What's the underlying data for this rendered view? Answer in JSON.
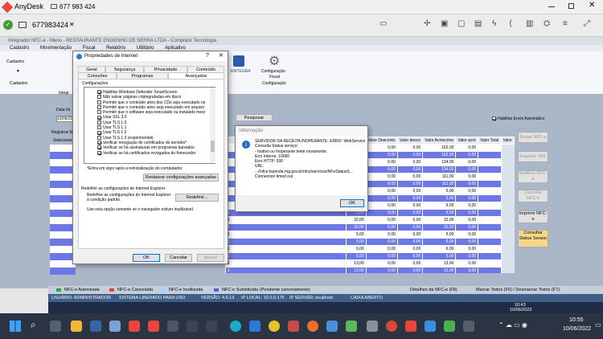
{
  "anydesk": {
    "app_name": "AnyDesk",
    "address_value": "677 983 424",
    "session_tab_label": "677983424"
  },
  "remote_app": {
    "window_title": "Integrador NFC-e - Menu - RESTAURANTE ENGENHO DE SERRA LTDA - Compilest Tecnologia",
    "menu": [
      "Cadastro",
      "Movimentação",
      "Fiscal",
      "Relatório",
      "Utilitário",
      "Aplicativo"
    ],
    "ribbon": {
      "left_button": "Cadastro",
      "left_group": "Cadastro",
      "integr_label": "Integr",
      "sintegra": "SINTEGRA",
      "config_line1": "Configuração",
      "config_line2": "Fiscal",
      "config_group": "Configuração"
    },
    "filter": {
      "data_label": "Data Ini",
      "data_value": "10/06/202",
      "search_button": "Pesquisar",
      "auto_label": "Habilitar Envio Automático"
    },
    "left_labels": {
      "registros": "Registros N",
      "selecionar": "Selecionar"
    },
    "grid": {
      "headers": [
        "SubTotal",
        "Valor Desconto",
        "Valor desco",
        "Valor Acréscimo",
        "Valor acré",
        "Valor Total",
        "Valor"
      ],
      "rows": [
        {
          "q": "",
          "v": [
            "162,00",
            "0,00",
            "0,00",
            "162,00",
            "0,00"
          ]
        },
        {
          "q": "",
          "v": [
            "162,00",
            "0,00",
            "0,00",
            "162,00",
            "0,00"
          ]
        },
        {
          "q": "",
          "v": [
            "134,00",
            "0,00",
            "0,00",
            "134,00",
            "0,00"
          ]
        },
        {
          "q": "",
          "v": [
            "134,00",
            "0,00",
            "0,00",
            "134,00",
            "0,00"
          ]
        },
        {
          "q": "",
          "v": [
            "111,00",
            "0,00",
            "0,00",
            "111,00",
            "0,00"
          ]
        },
        {
          "q": "",
          "v": [
            "111,00",
            "0,00",
            "0,00",
            "111,00",
            "0,00"
          ]
        },
        {
          "q": "",
          "v": [
            "5,00",
            "0,00",
            "0,00",
            "5,00",
            "0,00"
          ]
        },
        {
          "q": "",
          "v": [
            "5,00",
            "0,00",
            "0,00",
            "5,00",
            "0,00"
          ]
        },
        {
          "q": "",
          "v": [
            "9,00",
            "0,00",
            "0,00",
            "9,00",
            "0,00"
          ]
        },
        {
          "q": "1",
          "v": [
            "9,00",
            "0,00",
            "0,00",
            "9,00",
            "0,00"
          ]
        },
        {
          "q": "1",
          "v": [
            "32,00",
            "0,00",
            "0,00",
            "32,00",
            "0,00"
          ]
        },
        {
          "q": "1",
          "v": [
            "32,00",
            "0,00",
            "0,00",
            "32,00",
            "0,00"
          ]
        },
        {
          "q": "1",
          "v": [
            "5,00",
            "0,00",
            "0,00",
            "5,00",
            "0,00"
          ]
        },
        {
          "q": "1",
          "v": [
            "5,00",
            "0,00",
            "0,00",
            "5,00",
            "0,00"
          ]
        },
        {
          "q": "1",
          "v": [
            "6,00",
            "0,00",
            "0,00",
            "6,00",
            "0,00"
          ]
        },
        {
          "q": "1",
          "v": [
            "6,00",
            "0,00",
            "0,00",
            "6,00",
            "0,00"
          ]
        },
        {
          "q": "1",
          "v": [
            "13,00",
            "0,00",
            "0,00",
            "13,00",
            "0,00"
          ]
        },
        {
          "q": "1",
          "v": [
            "13,00",
            "0,00",
            "0,00",
            "13,00",
            "0,00"
          ]
        }
      ]
    },
    "side_buttons": [
      "Enviar NFC-e",
      "Exportar XML",
      "Inutilizar NFC-e",
      "Cancelar NFC-e",
      "Imprimir NFC-e",
      "Consultar Status Sensor"
    ],
    "legend": {
      "autorizada": "NFC-e Autorizada",
      "cancelada": "NFC-e Cancelada",
      "inutilizada": "NFC-e Inutilizada",
      "substituida": "NFC-e Substituída (Pendente cancelamento)",
      "detalhes": "Detalhes da NFC-e (F8)",
      "marcar": "Marcar Todos (F6) / Desmarcar Todos (F7)"
    },
    "statusbar": {
      "usuario": "USUÁRIO: ADMINISTRADOR",
      "sistema": "SISTEMA LIBERADO PARA USO",
      "versao": "VERSÃO: 4.6.13",
      "ip_local": "IP LOCAL: 10.0.0.175",
      "ip_server": "IP SERVER: localhost",
      "caixa": "CAIXA ABERTO"
    }
  },
  "internet_dialog": {
    "title": "Propriedades de Internet",
    "help": "?",
    "tabs_row1": [
      "Geral",
      "Segurança",
      "Privacidade",
      "Conteúdo"
    ],
    "tabs_row2": [
      "Conexões",
      "Programas",
      "Avançadas"
    ],
    "section": "Configurações",
    "items": [
      {
        "on": true,
        "t": "Habilitar Windows Defender SmartScreen"
      },
      {
        "on": false,
        "t": "Não salvar páginas criptografadas em disco"
      },
      {
        "on": false,
        "t": "Permitir que o conteúdo ativo dos CDs seja executado no"
      },
      {
        "on": false,
        "t": "Permitir que o conteúdo ativo seja executado em arquivo"
      },
      {
        "on": false,
        "t": "Permitir que o software seja executado ou instalado mesr"
      },
      {
        "on": true,
        "t": "Usar SSL 3.0"
      },
      {
        "on": false,
        "t": "Usar TLS 1.0"
      },
      {
        "on": false,
        "t": "Usar TLS 1.1"
      },
      {
        "on": true,
        "t": "Usar TLS 1.2"
      },
      {
        "on": false,
        "t": "Usar TLS 1.3 (experimental)"
      },
      {
        "on": true,
        "t": "Verificar revogação de certificados do servidor*"
      },
      {
        "on": true,
        "t": "Verificar se há assinaturas em programas baixados"
      },
      {
        "on": true,
        "t": "Verificar se há certificados revogados do fornecedor"
      }
    ],
    "restart_note": "*Entra em vigor após a reinicialização do computador",
    "restore_button": "Restaurar configurações avançadas",
    "reset_heading": "Redefinir as configurações do Internet Explorer",
    "reset_desc": "Redefine as configurações do Internet Explorer à condição padrão.",
    "reset_button": "Redefinir...",
    "reset_note": "Use esta opção somente se o navegador estiver inutilizável.",
    "ok": "OK",
    "cancel": "Cancelar",
    "apply": "Aplicar"
  },
  "info_dialog": {
    "title": "Informação",
    "lines": [
      "SERVIDOR DA RECEITA INOPERANTE, ERRO: WebService",
      "Consulta Status serviço:",
      "- Inativo ou Inoperante tente novamente.",
      "Erro Interno: 10060",
      "Erro HTTP: 500",
      "URL:",
      "..://nfce.fazenda.mg.gov.br/nfce/services/NFeStatusS...",
      "Connection timed out"
    ],
    "ok": "OK"
  },
  "taskbar": {
    "clock_time": "10:43",
    "clock_date": "10/06/2022",
    "sys_time": "10:55",
    "sys_date": "10/06/2022"
  }
}
